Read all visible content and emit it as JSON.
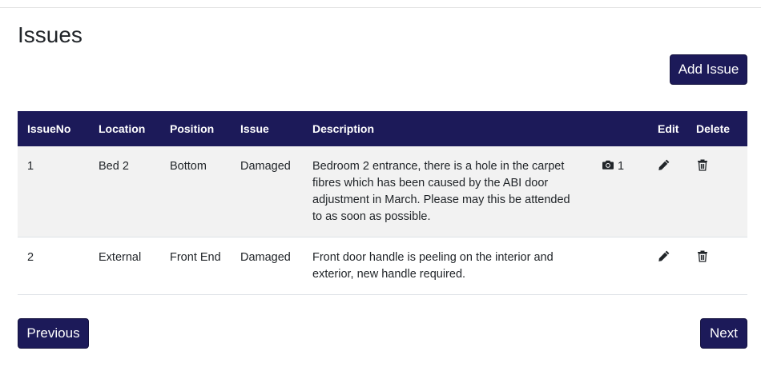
{
  "page": {
    "title": "Issues"
  },
  "actions": {
    "add_label": "Add Issue",
    "previous_label": "Previous",
    "next_label": "Next"
  },
  "table": {
    "headers": {
      "issue_no": "IssueNo",
      "location": "Location",
      "position": "Position",
      "issue": "Issue",
      "description": "Description",
      "photos": "",
      "edit": "Edit",
      "delete": "Delete"
    },
    "rows": [
      {
        "issue_no": "1",
        "location": "Bed 2",
        "position": "Bottom",
        "issue": "Damaged",
        "description": "Bedroom 2 entrance, there is a hole in the carpet fibres which has been caused by the ABI door adjustment in March. Please may this be attended to as soon as possible.",
        "photo_count": "1"
      },
      {
        "issue_no": "2",
        "location": "External",
        "position": "Front End",
        "issue": "Damaged",
        "description": "Front door handle is peeling on the interior and exterior, new handle required.",
        "photo_count": ""
      }
    ]
  },
  "colors": {
    "primary": "#1c1a59",
    "header_text": "#ffffff",
    "stripe": "#f2f2f2"
  },
  "icons": {
    "photo": "camera-icon",
    "edit": "pencil-icon",
    "delete": "trash-icon"
  }
}
